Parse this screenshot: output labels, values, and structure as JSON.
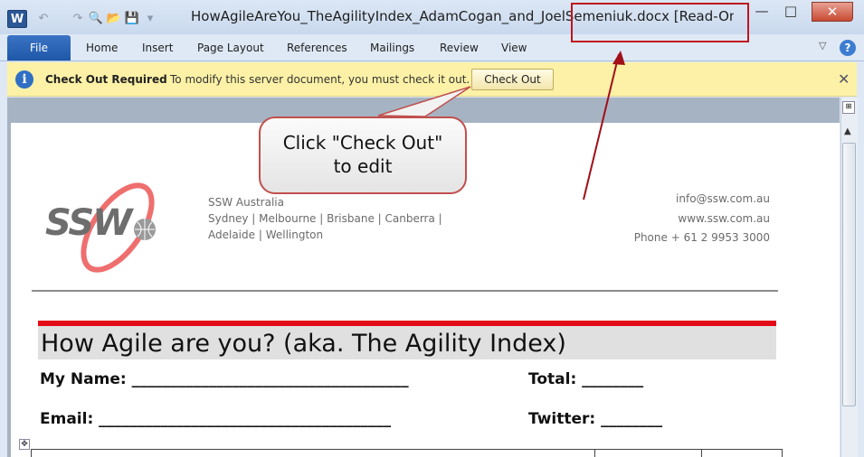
{
  "window": {
    "app_icon": "W",
    "title": "HowAgileAreYou_TheAgilityIndex_AdamCogan_and_JoelSemeniuk.docx [Read-Only] [Co...",
    "minimize": "—",
    "maximize": "□",
    "close": "✕"
  },
  "qat": {
    "undo": "↶",
    "redo": "↷",
    "print_preview": "🔍",
    "open": "📂",
    "save": "💾",
    "customize": "▾"
  },
  "ribbon": {
    "file": "File",
    "tabs": [
      "Home",
      "Insert",
      "Page Layout",
      "References",
      "Mailings",
      "Review",
      "View"
    ],
    "minimize": "▽",
    "help": "?"
  },
  "message_bar": {
    "title": "Check Out Required",
    "text": "To modify this server document, you must check it out.",
    "button": "Check Out",
    "close": "✕"
  },
  "callout": {
    "line1": "Click \"Check Out\"",
    "line2": "to edit"
  },
  "document": {
    "logo_text": "SSW",
    "company": "SSW Australia",
    "cities_line1": "Sydney  |  Melbourne  |  Brisbane  |  Canberra  |",
    "cities_line2": "Adelaide  |  Wellington",
    "email": "info@ssw.com.au",
    "web": "www.ssw.com.au",
    "phone": "Phone + 61 2 9953 3000",
    "title": "How Agile are you? (aka. The Agility Index)",
    "name_field": "My Name: ____________________________________",
    "total_field": "Total:     ________",
    "email_field": "Email: ______________________________________",
    "twitter_field": "Twitter: ________",
    "table_move": "✥"
  },
  "colors": {
    "accent_red": "#e20b17",
    "ribbon_blue": "#2b5797",
    "message_bar": "#fcf1a6"
  }
}
